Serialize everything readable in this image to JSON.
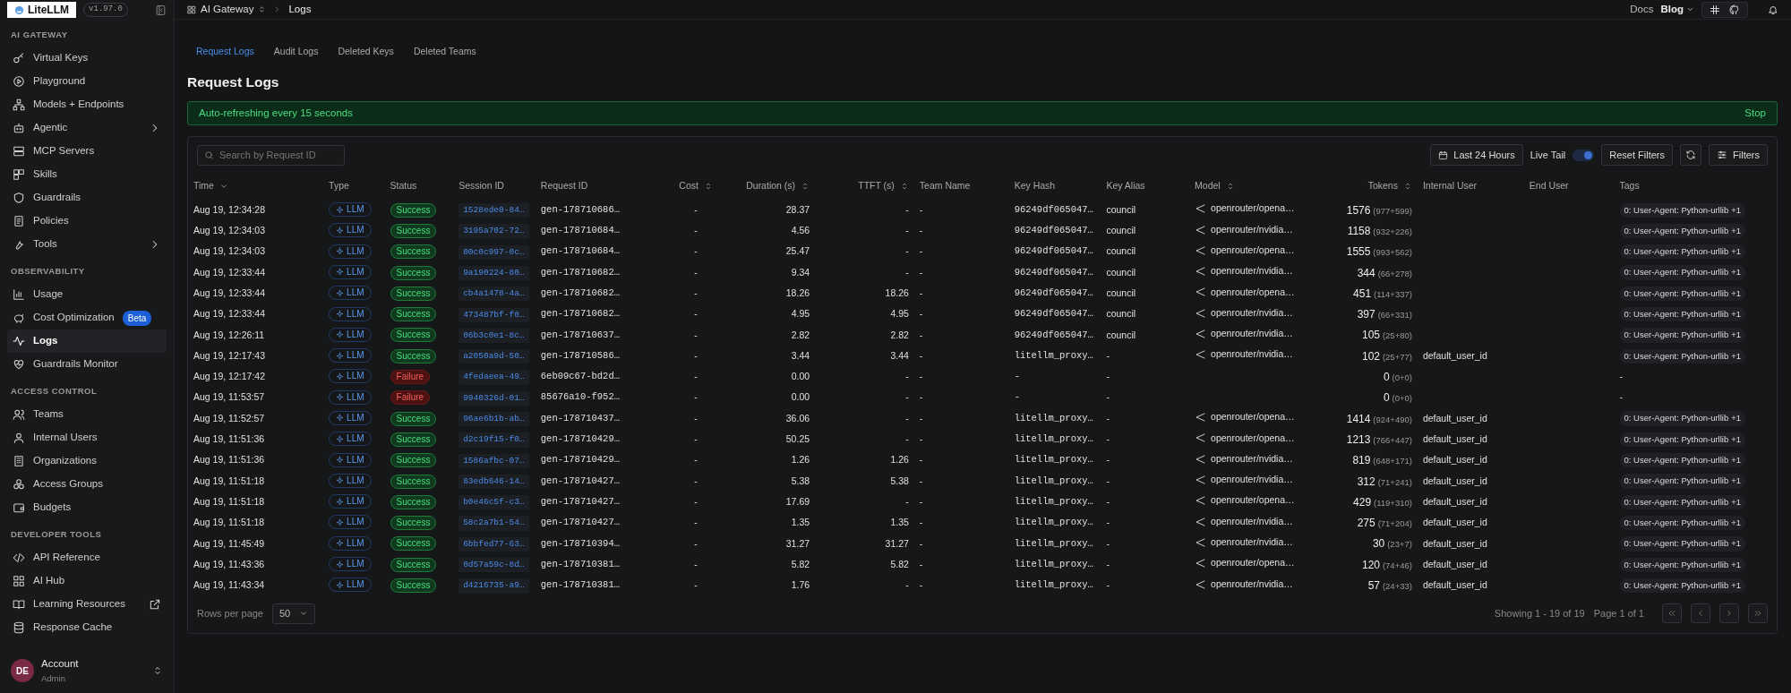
{
  "sidebar": {
    "logo": "LiteLLM",
    "version": "v1.97.0",
    "sections": [
      {
        "title": "AI GATEWAY",
        "items": [
          {
            "label": "Virtual Keys",
            "selected": false
          },
          {
            "label": "Playground",
            "selected": false
          },
          {
            "label": "Models + Endpoints",
            "selected": false
          },
          {
            "label": "Agentic",
            "selected": false,
            "submenu": true
          },
          {
            "label": "MCP Servers",
            "selected": false
          },
          {
            "label": "Skills",
            "selected": false
          },
          {
            "label": "Guardrails",
            "selected": false
          },
          {
            "label": "Policies",
            "selected": false
          },
          {
            "label": "Tools",
            "selected": false,
            "submenu": true
          }
        ]
      },
      {
        "title": "OBSERVABILITY",
        "items": [
          {
            "label": "Usage",
            "selected": false
          },
          {
            "label": "Cost Optimization",
            "selected": false,
            "badge": "Beta"
          },
          {
            "label": "Logs",
            "selected": true
          },
          {
            "label": "Guardrails Monitor",
            "selected": false
          }
        ]
      },
      {
        "title": "ACCESS CONTROL",
        "items": [
          {
            "label": "Teams",
            "selected": false
          },
          {
            "label": "Internal Users",
            "selected": false
          },
          {
            "label": "Organizations",
            "selected": false
          },
          {
            "label": "Access Groups",
            "selected": false
          },
          {
            "label": "Budgets",
            "selected": false
          }
        ]
      },
      {
        "title": "DEVELOPER TOOLS",
        "items": [
          {
            "label": "API Reference",
            "selected": false
          },
          {
            "label": "AI Hub",
            "selected": false
          },
          {
            "label": "Learning Resources",
            "selected": false,
            "external": true
          },
          {
            "label": "Response Cache",
            "selected": false
          }
        ]
      }
    ],
    "account": {
      "initials": "DE",
      "name": "Account",
      "role": "Admin"
    }
  },
  "breadcrumb": [
    "AI Gateway",
    "Logs"
  ],
  "top_links": [
    "Docs",
    "Blog"
  ],
  "tabs": [
    {
      "label": "Request Logs",
      "selected": true
    },
    {
      "label": "Audit Logs",
      "selected": false
    },
    {
      "label": "Deleted Keys",
      "selected": false
    },
    {
      "label": "Deleted Teams",
      "selected": false
    }
  ],
  "title": "Request Logs",
  "banner": {
    "text": "Auto-refreshing every 15 seconds",
    "action": "Stop"
  },
  "toolbar": {
    "search_placeholder": "Search by Request ID",
    "time_range": "Last 24 Hours",
    "live_tail": {
      "label": "Live Tail",
      "on": true
    },
    "reset": "Reset Filters",
    "filters": "Filters"
  },
  "table": {
    "columns": [
      {
        "label": "Time",
        "sorted": true
      },
      {
        "label": "Type"
      },
      {
        "label": "Status"
      },
      {
        "label": "Session ID"
      },
      {
        "label": "Request ID"
      },
      {
        "label": "Cost",
        "sortable": true
      },
      {
        "label": "Duration (s)",
        "sortable": true
      },
      {
        "label": "TTFT (s)",
        "sortable": true
      },
      {
        "label": "Team Name"
      },
      {
        "label": "Key Hash"
      },
      {
        "label": "Key Alias"
      },
      {
        "label": "Model",
        "sortable": true
      },
      {
        "label": "Tokens",
        "sortable": true
      },
      {
        "label": "Internal User"
      },
      {
        "label": "End User"
      },
      {
        "label": "Tags"
      }
    ],
    "rows": [
      {
        "time": "Aug 19, 12:34:28",
        "type": "LLM",
        "status": "Success",
        "session": "1528ede0-84…",
        "request": "gen-178710686…",
        "cost": "-",
        "duration": "28.37",
        "ttft": "-",
        "team": "-",
        "key_hash": "96249df065047…",
        "key_alias": "council",
        "model": "openrouter/opena…",
        "tokens": "1576",
        "tokens_split": "(977+599)",
        "tag": "0: User-Agent: Python-urllib",
        "tag_more": "+1"
      },
      {
        "time": "Aug 19, 12:34:03",
        "type": "LLM",
        "status": "Success",
        "session": "3195a702-72…",
        "request": "gen-178710684…",
        "cost": "-",
        "duration": "4.56",
        "ttft": "-",
        "team": "-",
        "key_hash": "96249df065047…",
        "key_alias": "council",
        "model": "openrouter/nvidia…",
        "tokens": "1158",
        "tokens_split": "(932+226)",
        "tag": "0: User-Agent: Python-urllib",
        "tag_more": "+1"
      },
      {
        "time": "Aug 19, 12:34:03",
        "type": "LLM",
        "status": "Success",
        "session": "00c0c997-0c…",
        "request": "gen-178710684…",
        "cost": "-",
        "duration": "25.47",
        "ttft": "-",
        "team": "-",
        "key_hash": "96249df065047…",
        "key_alias": "council",
        "model": "openrouter/opena…",
        "tokens": "1555",
        "tokens_split": "(993+562)",
        "tag": "0: User-Agent: Python-urllib",
        "tag_more": "+1"
      },
      {
        "time": "Aug 19, 12:33:44",
        "type": "LLM",
        "status": "Success",
        "session": "9a190224-80…",
        "request": "gen-178710682…",
        "cost": "-",
        "duration": "9.34",
        "ttft": "-",
        "team": "-",
        "key_hash": "96249df065047…",
        "key_alias": "council",
        "model": "openrouter/nvidia…",
        "tokens": "344",
        "tokens_split": "(66+278)",
        "tag": "0: User-Agent: Python-urllib",
        "tag_more": "+1"
      },
      {
        "time": "Aug 19, 12:33:44",
        "type": "LLM",
        "status": "Success",
        "session": "cb4a1478-4a…",
        "request": "gen-178710682…",
        "cost": "-",
        "duration": "18.26",
        "ttft": "18.26",
        "team": "-",
        "key_hash": "96249df065047…",
        "key_alias": "council",
        "model": "openrouter/opena…",
        "tokens": "451",
        "tokens_split": "(114+337)",
        "tag": "0: User-Agent: Python-urllib",
        "tag_more": "+1"
      },
      {
        "time": "Aug 19, 12:33:44",
        "type": "LLM",
        "status": "Success",
        "session": "473487bf-f0…",
        "request": "gen-178710682…",
        "cost": "-",
        "duration": "4.95",
        "ttft": "4.95",
        "team": "-",
        "key_hash": "96249df065047…",
        "key_alias": "council",
        "model": "openrouter/nvidia…",
        "tokens": "397",
        "tokens_split": "(66+331)",
        "tag": "0: User-Agent: Python-urllib",
        "tag_more": "+1"
      },
      {
        "time": "Aug 19, 12:26:11",
        "type": "LLM",
        "status": "Success",
        "session": "06b3c0e1-8c…",
        "request": "gen-178710637…",
        "cost": "-",
        "duration": "2.82",
        "ttft": "2.82",
        "team": "-",
        "key_hash": "96249df065047…",
        "key_alias": "council",
        "model": "openrouter/nvidia…",
        "tokens": "105",
        "tokens_split": "(25+80)",
        "tag": "0: User-Agent: Python-urllib",
        "tag_more": "+1"
      },
      {
        "time": "Aug 19, 12:17:43",
        "type": "LLM",
        "status": "Success",
        "session": "a2050a9d-50…",
        "request": "gen-178710586…",
        "cost": "-",
        "duration": "3.44",
        "ttft": "3.44",
        "team": "-",
        "key_hash": "litellm_proxy…",
        "key_alias": "-",
        "model": "openrouter/nvidia…",
        "tokens": "102",
        "tokens_split": "(25+77)",
        "internal_user": "default_user_id",
        "tag": "0: User-Agent: Python-urllib",
        "tag_more": "+1"
      },
      {
        "time": "Aug 19, 12:17:42",
        "type": "LLM",
        "status": "Failure",
        "session": "4fedaeea-49…",
        "request": "6eb09c67-bd2d…",
        "cost": "-",
        "duration": "0.00",
        "ttft": "-",
        "team": "-",
        "key_hash": "-",
        "key_alias": "-",
        "tokens": "0",
        "tokens_split": "(0+0)",
        "tag_none": "-"
      },
      {
        "time": "Aug 19, 11:53:57",
        "type": "LLM",
        "status": "Failure",
        "session": "9940326d-01…",
        "request": "85676a10-f952…",
        "cost": "-",
        "duration": "0.00",
        "ttft": "-",
        "team": "-",
        "key_hash": "-",
        "key_alias": "-",
        "tokens": "0",
        "tokens_split": "(0+0)",
        "tag_none": "-"
      },
      {
        "time": "Aug 19, 11:52:57",
        "type": "LLM",
        "status": "Success",
        "session": "96ae6b1b-ab…",
        "request": "gen-178710437…",
        "cost": "-",
        "duration": "36.06",
        "ttft": "-",
        "team": "-",
        "key_hash": "litellm_proxy…",
        "key_alias": "-",
        "model": "openrouter/opena…",
        "tokens": "1414",
        "tokens_split": "(924+490)",
        "internal_user": "default_user_id",
        "tag": "0: User-Agent: Python-urllib",
        "tag_more": "+1"
      },
      {
        "time": "Aug 19, 11:51:36",
        "type": "LLM",
        "status": "Success",
        "session": "d2c19f15-f0…",
        "request": "gen-178710429…",
        "cost": "-",
        "duration": "50.25",
        "ttft": "-",
        "team": "-",
        "key_hash": "litellm_proxy…",
        "key_alias": "-",
        "model": "openrouter/opena…",
        "tokens": "1213",
        "tokens_split": "(766+447)",
        "internal_user": "default_user_id",
        "tag": "0: User-Agent: Python-urllib",
        "tag_more": "+1"
      },
      {
        "time": "Aug 19, 11:51:36",
        "type": "LLM",
        "status": "Success",
        "session": "1586afbc-07…",
        "request": "gen-178710429…",
        "cost": "-",
        "duration": "1.26",
        "ttft": "1.26",
        "team": "-",
        "key_hash": "litellm_proxy…",
        "key_alias": "-",
        "model": "openrouter/nvidia…",
        "tokens": "819",
        "tokens_split": "(648+171)",
        "internal_user": "default_user_id",
        "tag": "0: User-Agent: Python-urllib",
        "tag_more": "+1"
      },
      {
        "time": "Aug 19, 11:51:18",
        "type": "LLM",
        "status": "Success",
        "session": "83edb646-14…",
        "request": "gen-178710427…",
        "cost": "-",
        "duration": "5.38",
        "ttft": "5.38",
        "team": "-",
        "key_hash": "litellm_proxy…",
        "key_alias": "-",
        "model": "openrouter/nvidia…",
        "tokens": "312",
        "tokens_split": "(71+241)",
        "internal_user": "default_user_id",
        "tag": "0: User-Agent: Python-urllib",
        "tag_more": "+1"
      },
      {
        "time": "Aug 19, 11:51:18",
        "type": "LLM",
        "status": "Success",
        "session": "b0e46c5f-c3…",
        "request": "gen-178710427…",
        "cost": "-",
        "duration": "17.69",
        "ttft": "-",
        "team": "-",
        "key_hash": "litellm_proxy…",
        "key_alias": "-",
        "model": "openrouter/opena…",
        "tokens": "429",
        "tokens_split": "(119+310)",
        "internal_user": "default_user_id",
        "tag": "0: User-Agent: Python-urllib",
        "tag_more": "+1"
      },
      {
        "time": "Aug 19, 11:51:18",
        "type": "LLM",
        "status": "Success",
        "session": "58c2a7b1-54…",
        "request": "gen-178710427…",
        "cost": "-",
        "duration": "1.35",
        "ttft": "1.35",
        "team": "-",
        "key_hash": "litellm_proxy…",
        "key_alias": "-",
        "model": "openrouter/nvidia…",
        "tokens": "275",
        "tokens_split": "(71+204)",
        "internal_user": "default_user_id",
        "tag": "0: User-Agent: Python-urllib",
        "tag_more": "+1"
      },
      {
        "time": "Aug 19, 11:45:49",
        "type": "LLM",
        "status": "Success",
        "session": "6bbfed77-63…",
        "request": "gen-178710394…",
        "cost": "-",
        "duration": "31.27",
        "ttft": "31.27",
        "team": "-",
        "key_hash": "litellm_proxy…",
        "key_alias": "-",
        "model": "openrouter/nvidia…",
        "tokens": "30",
        "tokens_split": "(23+7)",
        "internal_user": "default_user_id",
        "tag": "0: User-Agent: Python-urllib",
        "tag_more": "+1"
      },
      {
        "time": "Aug 19, 11:43:36",
        "type": "LLM",
        "status": "Success",
        "session": "0d57a59c-8d…",
        "request": "gen-178710381…",
        "cost": "-",
        "duration": "5.82",
        "ttft": "5.82",
        "team": "-",
        "key_hash": "litellm_proxy…",
        "key_alias": "-",
        "model": "openrouter/opena…",
        "tokens": "120",
        "tokens_split": "(74+46)",
        "internal_user": "default_user_id",
        "tag": "0: User-Agent: Python-urllib",
        "tag_more": "+1"
      },
      {
        "time": "Aug 19, 11:43:34",
        "type": "LLM",
        "status": "Success",
        "session": "d4216735-a9…",
        "request": "gen-178710381…",
        "cost": "-",
        "duration": "1.76",
        "ttft": "-",
        "team": "-",
        "key_hash": "litellm_proxy…",
        "key_alias": "-",
        "model": "openrouter/nvidia…",
        "tokens": "57",
        "tokens_split": "(24+33)",
        "internal_user": "default_user_id",
        "tag": "0: User-Agent: Python-urllib",
        "tag_more": "+1"
      }
    ]
  },
  "footer": {
    "rows_per_page_label": "Rows per page",
    "rows_per_page": "50",
    "showing": "Showing 1 - 19 of 19",
    "page": "Page 1 of 1"
  }
}
